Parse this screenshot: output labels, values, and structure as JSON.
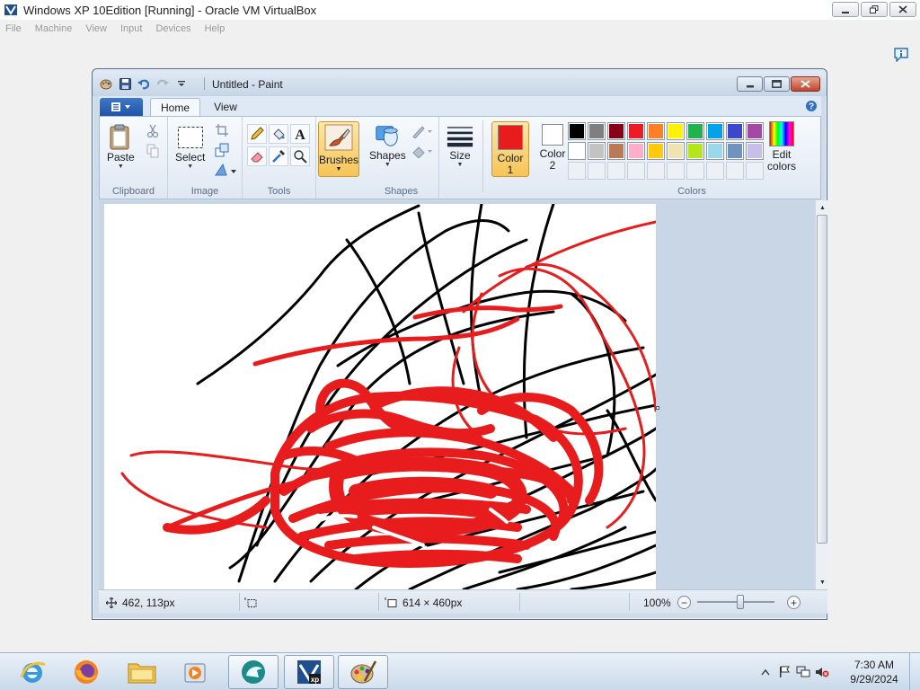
{
  "host": {
    "title": "Windows XP 10Edition [Running] - Oracle VM VirtualBox",
    "menu": [
      "File",
      "Machine",
      "View",
      "Input",
      "Devices",
      "Help"
    ]
  },
  "paint": {
    "title": "Untitled - Paint",
    "tabs": [
      "Home",
      "View"
    ],
    "active_tab": "Home",
    "groups": {
      "clipboard": "Clipboard",
      "image": "Image",
      "tools": "Tools",
      "shapes": "Shapes",
      "colors": "Colors"
    },
    "buttons": {
      "paste": "Paste",
      "select": "Select",
      "brushes": "Brushes",
      "shapes": "Shapes",
      "size": "Size",
      "color1": "Color 1",
      "color2": "Color 2",
      "edit_colors": "Edit colors"
    },
    "color1_value": "#e81c1c",
    "color2_value": "#ffffff",
    "palette": [
      "#000000",
      "#7f7f7f",
      "#880015",
      "#ed1c24",
      "#ff7f27",
      "#fff200",
      "#22b14c",
      "#00a2e8",
      "#3f48cc",
      "#a349a4",
      "#ffffff",
      "#c3c3c3",
      "#b97a57",
      "#ffaec9",
      "#ffc90e",
      "#efe4b0",
      "#b5e61d",
      "#99d9ea",
      "#7092be",
      "#c8bfe7"
    ],
    "status": {
      "cursor_pos": "462, 113px",
      "selection_size": "",
      "image_size": "614 × 460px",
      "zoom": "100%"
    }
  },
  "taskbar": {
    "apps": [
      "internet-explorer",
      "firefox",
      "file-explorer",
      "media-player",
      "virtualbox-tool",
      "virtualbox-xp",
      "paint"
    ],
    "time": "7:30 AM",
    "date": "9/29/2024"
  },
  "icons": {
    "qat": [
      "paint-app-icon",
      "save-icon",
      "undo-icon",
      "redo-icon",
      "customize-qat-icon"
    ],
    "tray": [
      "show-hidden-icons-icon",
      "action-center-flag-icon",
      "network-icon",
      "volume-muted-icon"
    ]
  }
}
